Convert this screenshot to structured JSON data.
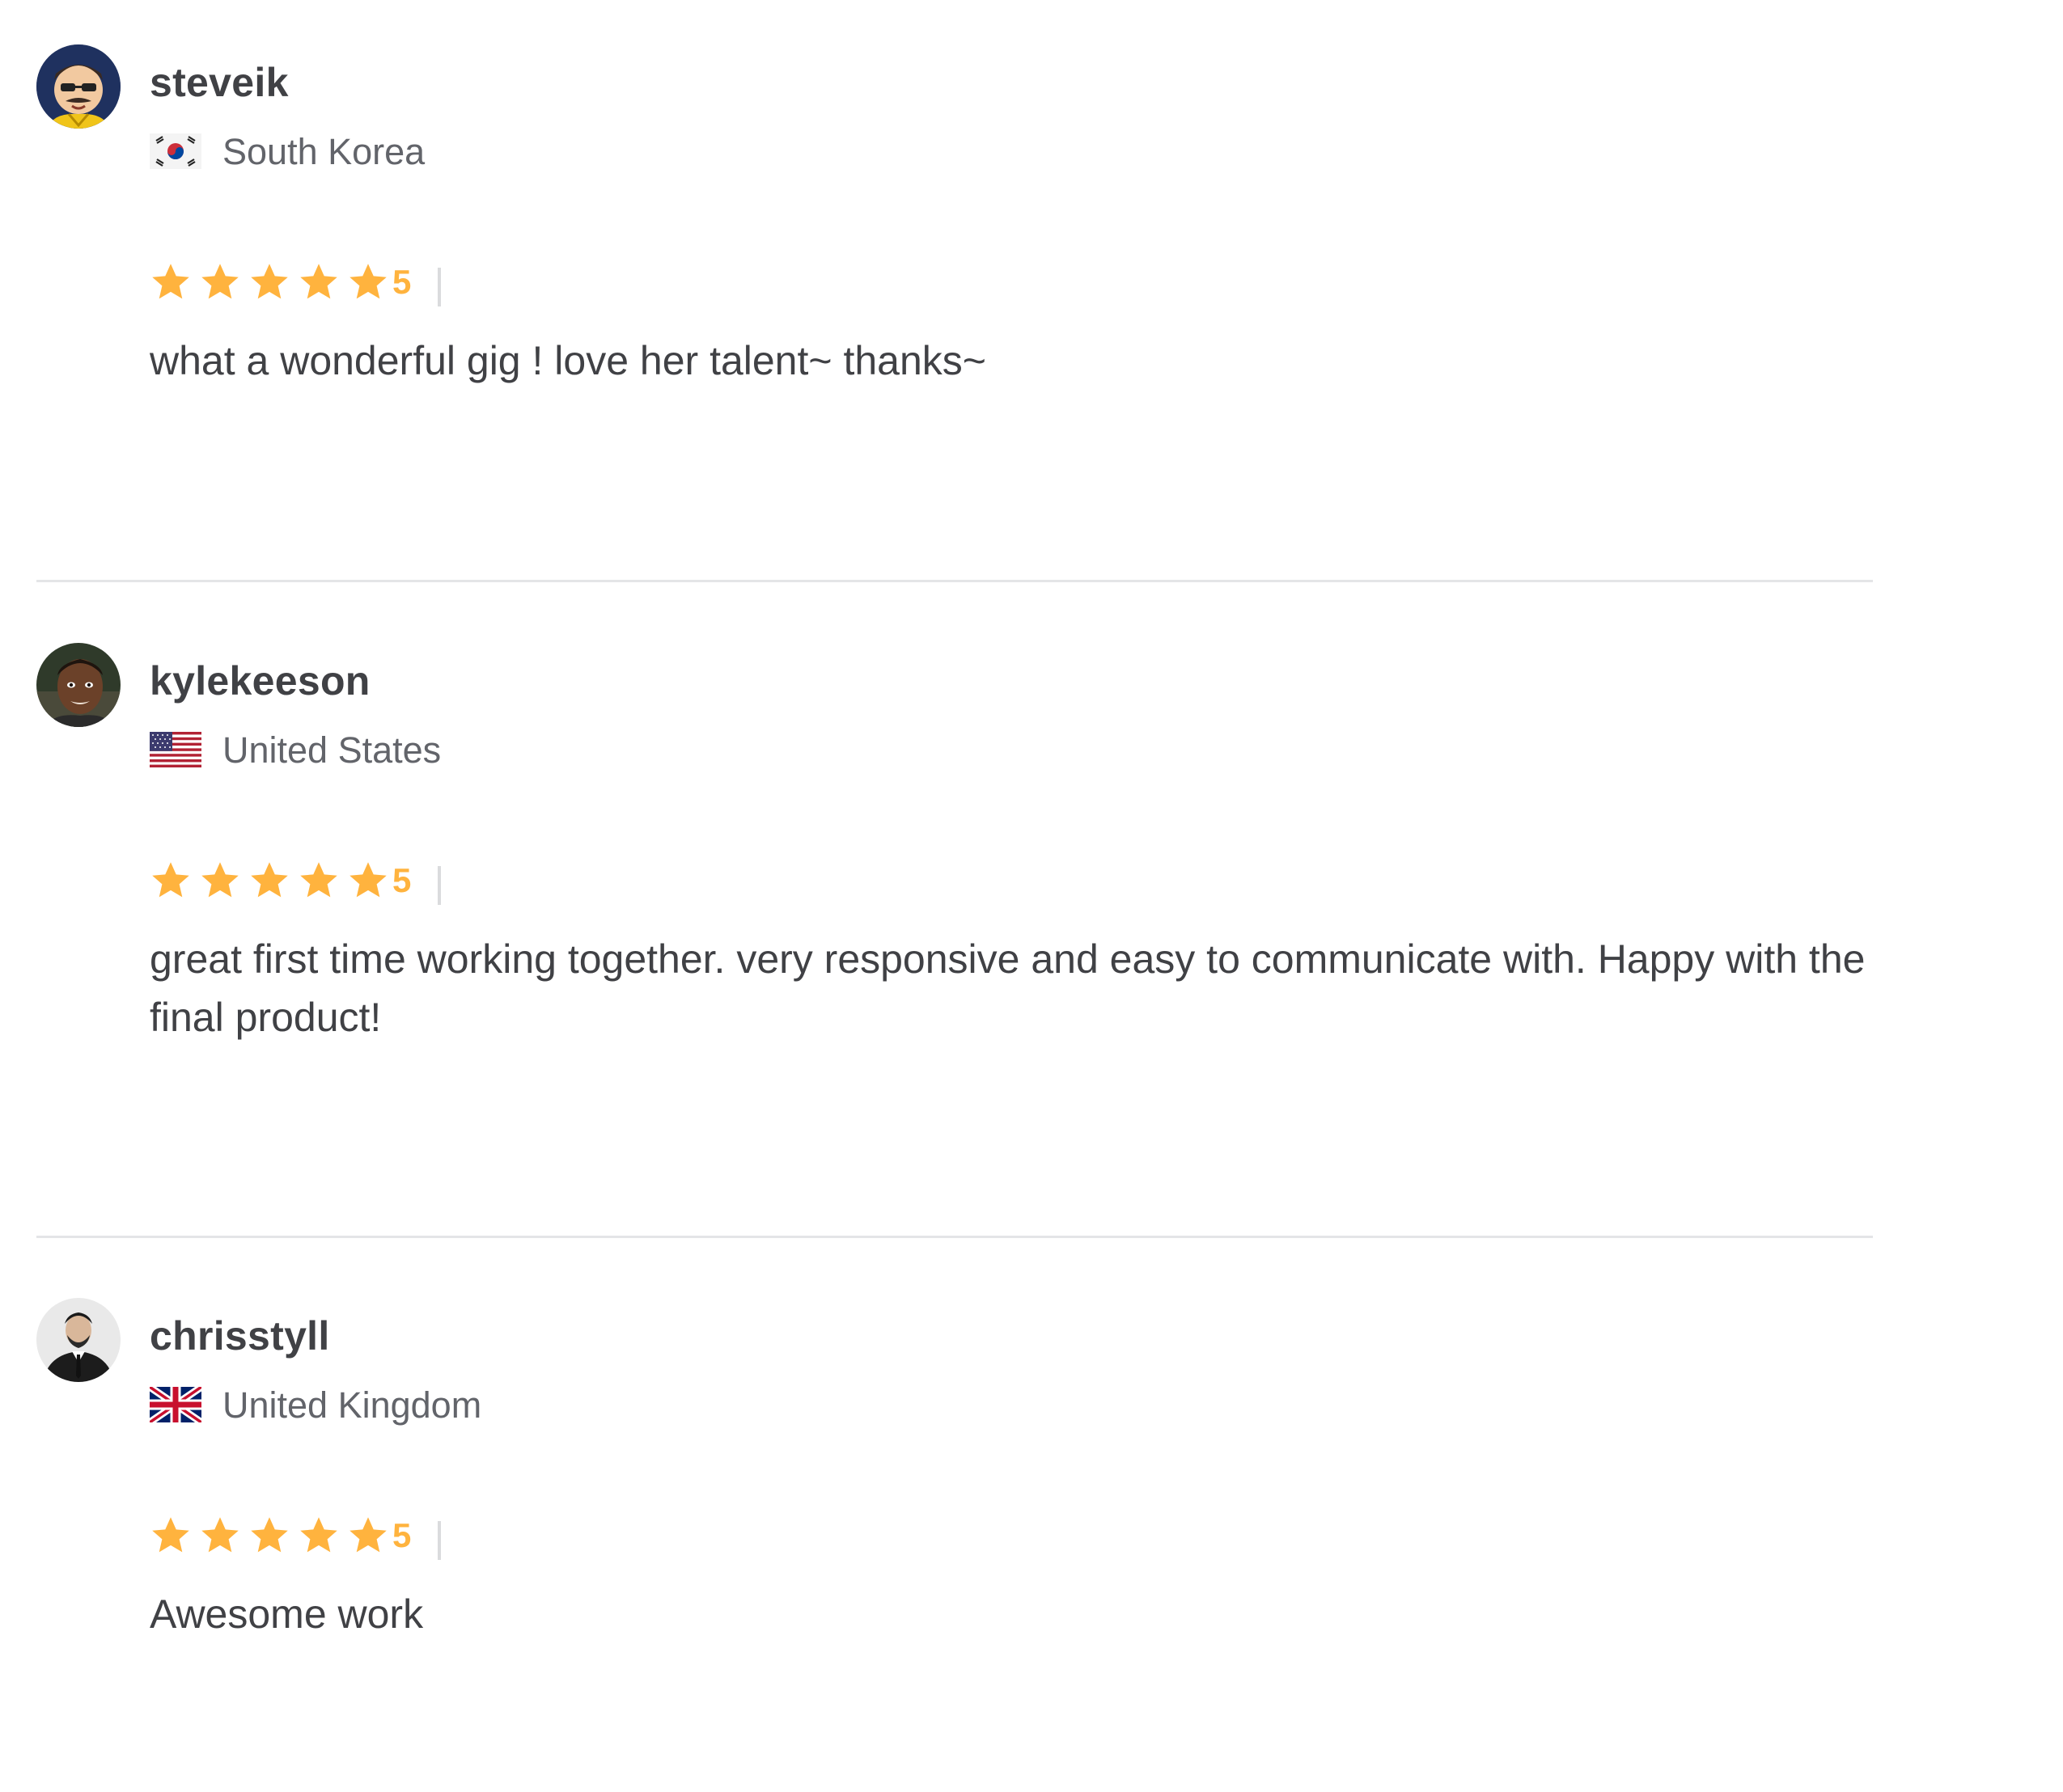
{
  "reviews": [
    {
      "username": "steveik",
      "country": "South Korea",
      "flag": "south-korea-flag-icon",
      "avatar": "cartoon-avatar",
      "rating": "5",
      "stars_filled": 5,
      "stars_total": 5,
      "text": "what a wonderful gig ! love her talent~ thanks~"
    },
    {
      "username": "kylekeeson",
      "country": "United States",
      "flag": "united-states-flag-icon",
      "avatar": "photo-avatar",
      "rating": "5",
      "stars_filled": 5,
      "stars_total": 5,
      "text": "great first time working together. very responsive and easy to communicate with. Happy with the final product!"
    },
    {
      "username": "chrisstyll",
      "country": "United Kingdom",
      "flag": "united-kingdom-flag-icon",
      "avatar": "photo-avatar",
      "rating": "5",
      "stars_filled": 5,
      "stars_total": 5,
      "text": "Awesome work"
    }
  ],
  "colors": {
    "star": "#ffb33e",
    "username": "#404145",
    "country": "#62646a",
    "divider": "#e4e5e7"
  }
}
